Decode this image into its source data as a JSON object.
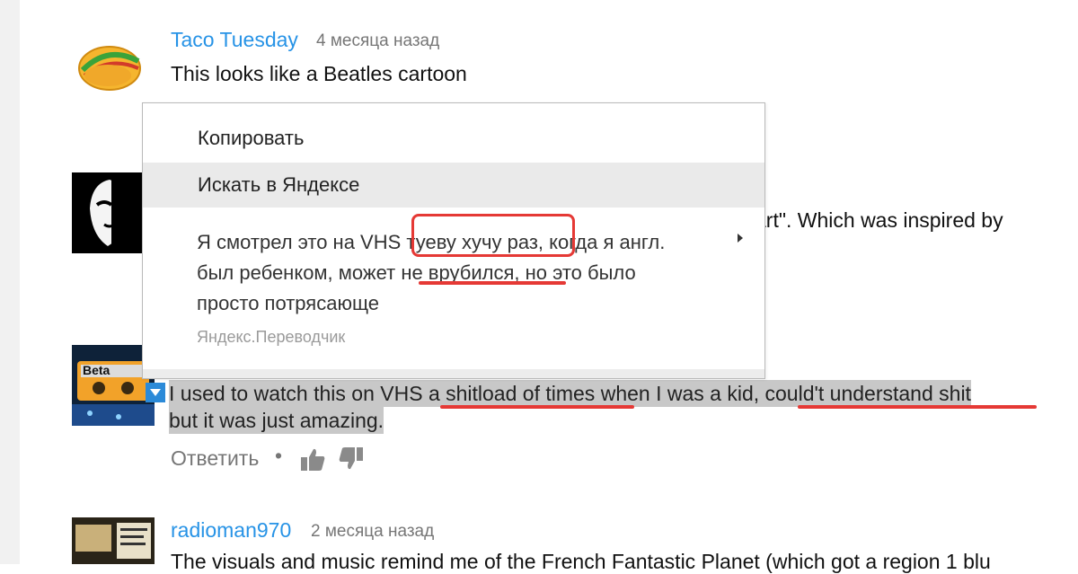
{
  "comments": [
    {
      "author": "Taco Tuesday",
      "time": "4 месяца назад",
      "text": "This looks like a Beatles cartoon"
    },
    {
      "text_fragment": "art\". Which was inspired by"
    },
    {
      "text_line1_parts": [
        "I used to watch this on VHS ",
        "a shitload of times",
        " when I was a kid, ",
        "could't understand shit"
      ],
      "text_line2": "but it was just amazing.",
      "avatar_label": "Beta"
    },
    {
      "author": "radioman970",
      "time": "2 месяца назад",
      "text": "The visuals and music remind me of the French Fantastic Planet (which got a region 1 blu"
    }
  ],
  "actions": {
    "reply": "Ответить",
    "separator": "•"
  },
  "context_menu": {
    "copy": "Копировать",
    "search": "Искать в Яндексе",
    "translation_lines": [
      [
        "Я смотрел это на VHS ",
        "туеву хучу раз,",
        " когда я    англ."
      ],
      [
        "был ребенком, может ",
        "не врубился,",
        " но это было"
      ],
      [
        "просто потрясающе"
      ]
    ],
    "source": "Яндекс.Переводчик"
  },
  "colors": {
    "author": "#2793e6",
    "annotation": "#e53935",
    "selection": "#c8c8c8",
    "expand_button": "#2b8ad8"
  },
  "icons": [
    "taco-avatar",
    "mask-avatar",
    "cassette-avatar",
    "radio-avatar",
    "thumbs-up-icon",
    "thumbs-down-icon",
    "submenu-arrow-icon",
    "expand-icon"
  ]
}
